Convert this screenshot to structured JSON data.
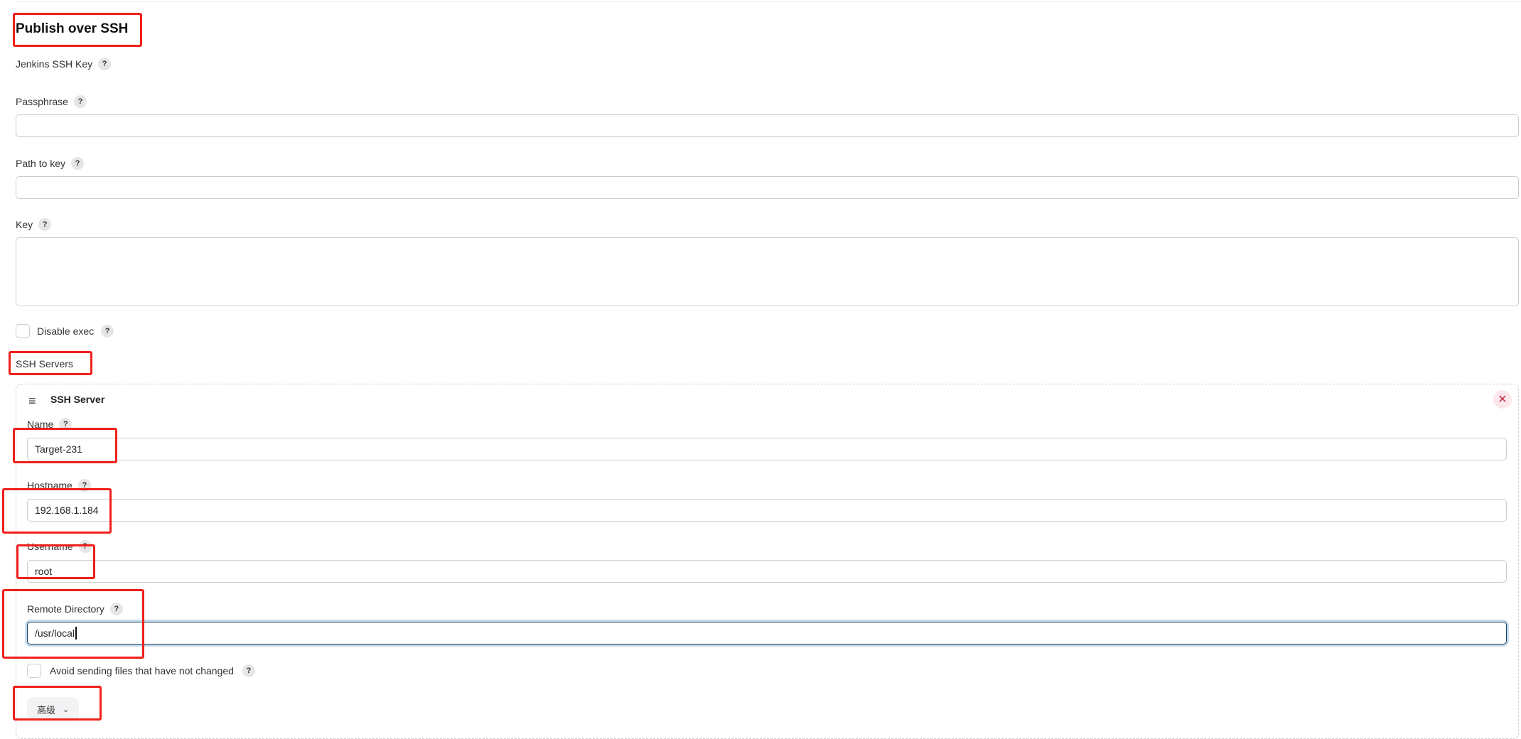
{
  "section_title": "Publish over SSH",
  "fields": {
    "jenkins_ssh_key": "Jenkins SSH Key",
    "passphrase": {
      "label": "Passphrase",
      "value": ""
    },
    "path_to_key": {
      "label": "Path to key",
      "value": ""
    },
    "key": {
      "label": "Key",
      "value": ""
    },
    "disable_exec": {
      "label": "Disable exec",
      "checked": false
    }
  },
  "help_glyph": "?",
  "ssh_servers_label": "SSH Servers",
  "server": {
    "header": "SSH Server",
    "close_glyph": "✕",
    "name": {
      "label": "Name",
      "value": "Target-231"
    },
    "hostname": {
      "label": "Hostname",
      "value": "192.168.1.184"
    },
    "username": {
      "label": "Username",
      "value": "root"
    },
    "remote_directory": {
      "label": "Remote Directory",
      "value": "/usr/local"
    },
    "avoid_sending": {
      "label": "Avoid sending files that have not changed",
      "checked": false
    },
    "advanced_label": "高级"
  },
  "colors": {
    "annotation": "#f0201a",
    "focus": "#1d3a55",
    "close": "#c0304a"
  }
}
